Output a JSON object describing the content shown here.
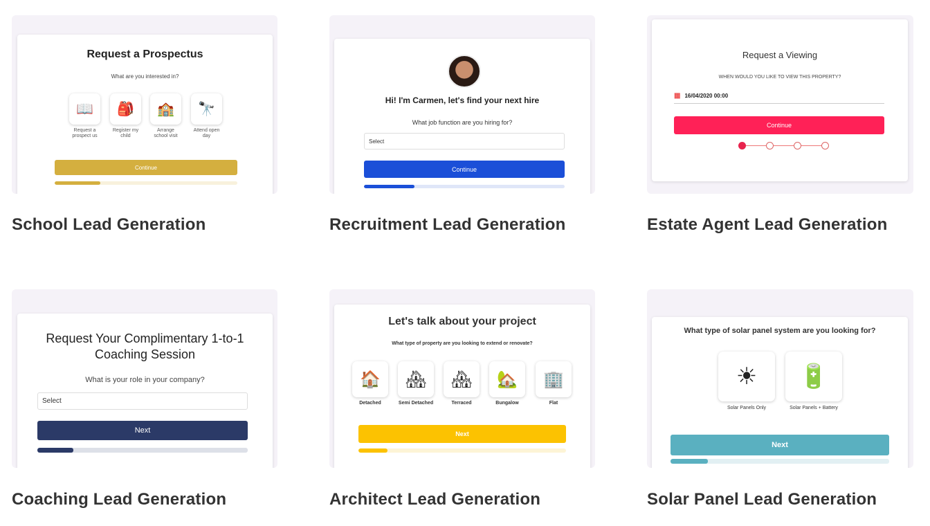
{
  "cards": [
    {
      "title": "School Lead Generation",
      "heading": "Request a Prospectus",
      "question": "What are you interested in?",
      "options": [
        {
          "label": "Request a prospect us",
          "icon": "book-icon"
        },
        {
          "label": "Register my child",
          "icon": "backpack-icon"
        },
        {
          "label": "Arrange school visit",
          "icon": "school-icon"
        },
        {
          "label": "Attend open day",
          "icon": "telescope-icon"
        }
      ],
      "button": "Continue",
      "progress": 0.25,
      "accent": "#d4af3f"
    },
    {
      "title": "Recruitment Lead Generation",
      "heading": "Hi! I'm Carmen, let's find your next hire",
      "question": "What job function are you hiring for?",
      "select": "Select",
      "button": "Continue",
      "progress": 0.2,
      "accent": "#1b4fd8"
    },
    {
      "title": "Estate Agent Lead Generation",
      "heading": "Request a Viewing",
      "question": "WHEN WOULD YOU LIKE TO VIEW THIS PROPERTY?",
      "date": "16/04/2020 00:00",
      "button": "Continue",
      "step": 1,
      "steps": 4,
      "accent": "#ff2157"
    },
    {
      "title": "Coaching Lead Generation",
      "heading_line1": "Request Your Complimentary 1-to-1",
      "heading_line2": "Coaching Session",
      "question": "What is your role in your company?",
      "select": "Select",
      "button": "Next",
      "progress": 0.17,
      "accent": "#2b3a67"
    },
    {
      "title": "Architect Lead Generation",
      "heading": "Let's talk about your project",
      "question": "What type of property are you looking to extend or renovate?",
      "options": [
        {
          "label": "Detached",
          "icon": "detached-house-icon"
        },
        {
          "label": "Semi Detached",
          "icon": "semi-detached-house-icon"
        },
        {
          "label": "Terraced",
          "icon": "terraced-house-icon"
        },
        {
          "label": "Bungalow",
          "icon": "bungalow-icon"
        },
        {
          "label": "Flat",
          "icon": "flat-icon"
        }
      ],
      "button": "Next",
      "progress": 0.1,
      "accent": "#fcc201"
    },
    {
      "title": "Solar Panel Lead Generation",
      "heading": "What type of solar panel system are you looking for?",
      "options": [
        {
          "label": "Solar Panels Only",
          "icon": "solar-panel-icon"
        },
        {
          "label": "Solar Panels + Battery",
          "icon": "solar-panel-battery-icon"
        }
      ],
      "button": "Next",
      "progress": 0.17,
      "accent": "#5ab0c0"
    }
  ]
}
